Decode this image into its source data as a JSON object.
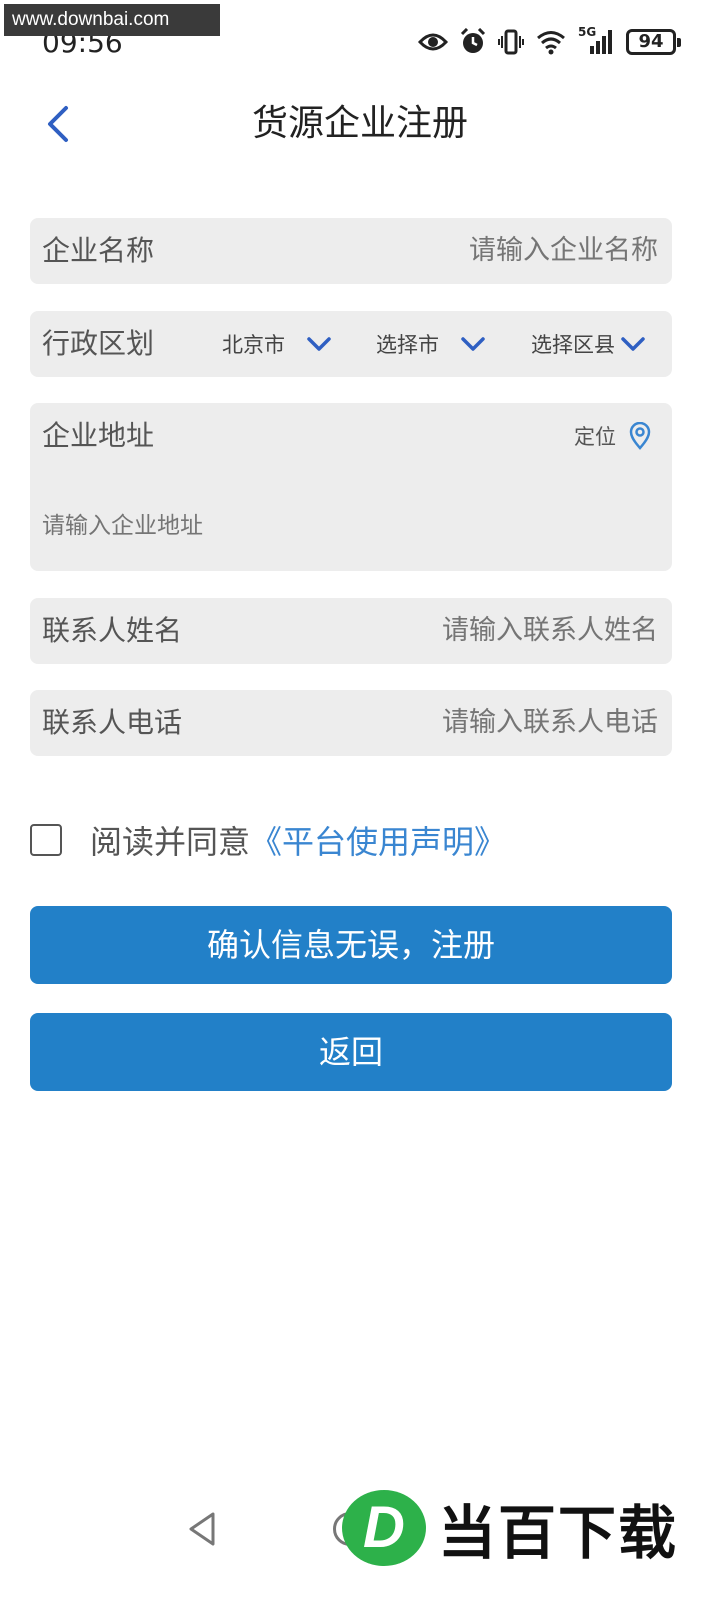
{
  "watermark": {
    "url": "www.downbai.com",
    "logo_letter": "D",
    "logo_text": "当百下载"
  },
  "status_bar": {
    "time": "09:56",
    "network": "5G",
    "battery": "94"
  },
  "header": {
    "title": "货源企业注册"
  },
  "form": {
    "company_name": {
      "label": "企业名称",
      "placeholder": "请输入企业名称"
    },
    "region": {
      "label": "行政区划",
      "province": "北京市",
      "city": "选择市",
      "district": "选择区县"
    },
    "address": {
      "label": "企业地址",
      "locate": "定位",
      "placeholder": "请输入企业地址"
    },
    "contact_name": {
      "label": "联系人姓名",
      "placeholder": "请输入联系人姓名"
    },
    "contact_phone": {
      "label": "联系人电话",
      "placeholder": "请输入联系人电话"
    }
  },
  "agreement": {
    "text": "阅读并同意",
    "link": "《平台使用声明》"
  },
  "buttons": {
    "confirm": "确认信息无误，注册",
    "back": "返回"
  },
  "colors": {
    "accent": "#2280c8",
    "link": "#3a86d1",
    "chevron": "#2f5fc2",
    "field_bg": "#ededed"
  }
}
